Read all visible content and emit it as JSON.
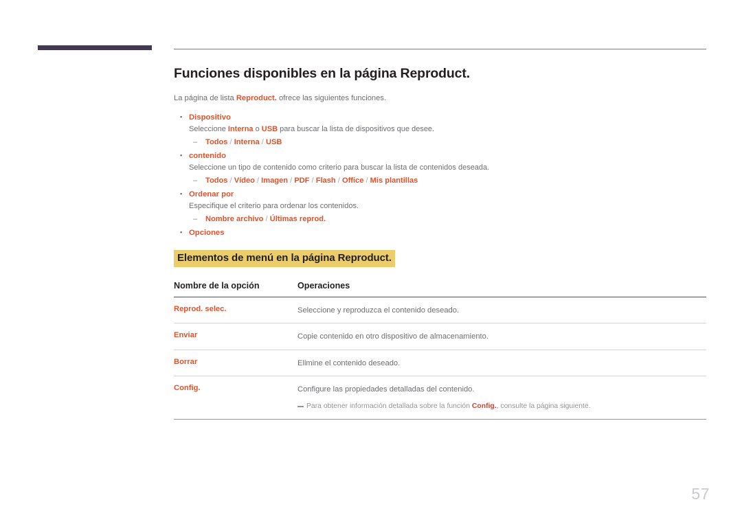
{
  "page": {
    "number": "57",
    "corner_bar_color": "#433a52",
    "accent_color": "#e0522b",
    "highlight_color": "#ebce6b",
    "body_text_color": "#6d6e71"
  },
  "heading": {
    "title": "Funciones disponibles en la página Reproduct.",
    "intro_before": "La página de lista ",
    "intro_highlight": "Reproduct.",
    "intro_after": " ofrece las siguientes funciones."
  },
  "features": [
    {
      "name": "Dispositivo",
      "desc_before": "Seleccione ",
      "desc_hl1": "Interna",
      "desc_mid": " o ",
      "desc_hl2": "USB",
      "desc_after": " para buscar la lista de dispositivos que desee.",
      "options": "Todos / Interna / USB"
    },
    {
      "name": "contenido",
      "desc": "Seleccione un tipo de contenido como criterio para buscar la lista de contenidos deseada.",
      "options": "Todos / Vídeo / Imagen / PDF / Flash / Office / Mis plantillas"
    },
    {
      "name": "Ordenar por",
      "desc": "Especifique el criterio para ordenar los contenidos.",
      "options": "Nombre archivo / Últimas reprod."
    },
    {
      "name": "Opciones"
    }
  ],
  "subheading": {
    "label": "Elementos de menú en la página Reproduct."
  },
  "table": {
    "headers": [
      "Nombre de la opción",
      "Operaciones"
    ],
    "rows": [
      {
        "option": "Reprod. selec.",
        "operation": "Seleccione y reproduzca el contenido deseado."
      },
      {
        "option": "Enviar",
        "operation": "Copie contenido en otro dispositivo de almacenamiento."
      },
      {
        "option": "Borrar",
        "operation": "Elimine el contenido deseado."
      },
      {
        "option": "Config.",
        "operation": "Configure las propiedades detalladas del contenido.",
        "note_before": "Para obtener información detallada sobre la función ",
        "note_highlight": "Config.",
        "note_after": ", consulte la página siguiente."
      }
    ]
  }
}
